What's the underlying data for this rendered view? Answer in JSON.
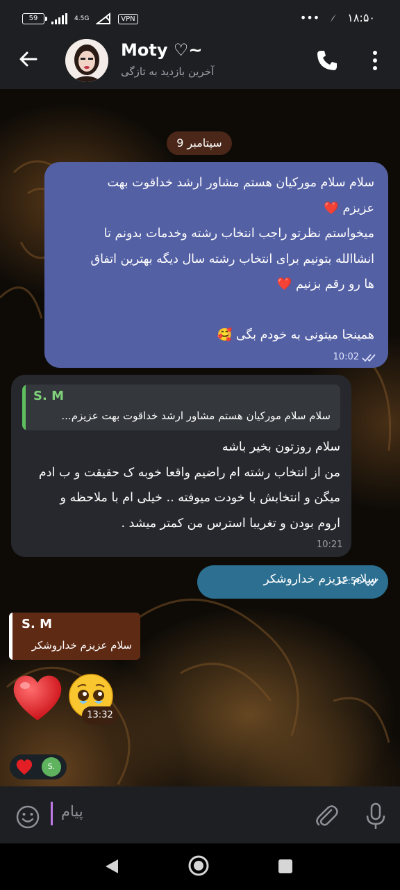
{
  "status_bar": {
    "battery": "59",
    "network": "4.5G",
    "vpn": "VPN",
    "icons": [
      "battery-icon",
      "signal-icon",
      "wifi-off-icon",
      "vpn-icon",
      "more-dots-icon",
      "location-arrow-icon"
    ],
    "time": "۱۸:۵۰"
  },
  "header": {
    "contact_name": "Moty ♡~",
    "last_seen": "آخرین بازدید به تازگی",
    "icons": [
      "back-arrow-icon",
      "phone-icon",
      "more-vert-icon"
    ]
  },
  "chat": {
    "date_label": "9 سپتامبر",
    "messages": [
      {
        "direction": "outgoing",
        "lines": [
          "سلام سلام  مورکیان هستم مشاور ارشد خداقوت بهت",
          "عزیزم ❤️",
          "میخواستم نظرتو راجب انتخاب رشته وخدمات بدونم تا",
          "انشاالله بتونیم برای انتخاب رشته سال دیگه  بهترین اتفاق",
          "ها رو رقم بزنیم ❤️",
          "",
          "همینجا میتونی به خودم بگی 🥰"
        ],
        "time": "10:02",
        "status": "read"
      },
      {
        "direction": "incoming",
        "reply": {
          "name": "S. M",
          "text": "سلام سلام  مورکیان هستم مشاور ارشد خداقوت بهت عزیزم..."
        },
        "lines": [
          "سلام روزتون بخیر باشه",
          "من از انتخاب رشته ام راضیم واقعا خوبه ک حقیقت و ب ادم",
          "میگن و انتخابش با خودت میوفته .. خیلی ام با ملاحظه و",
          "اروم بودن و تغریبا استرس من کمتر میشد ."
        ],
        "time": "10:21"
      },
      {
        "direction": "outgoing",
        "text": "سلام عزیزم خداروشکر",
        "time": "12:56",
        "status": "read"
      },
      {
        "direction": "incoming",
        "reply": {
          "name": "S. M",
          "text": "سلام عزیزم خداروشکر"
        },
        "emojis": [
          "heart-emoji",
          "pleading-face-emoji"
        ],
        "time": "13:32",
        "reactions": {
          "emoji": "heart-emoji",
          "user_initial": "S."
        }
      }
    ]
  },
  "input": {
    "placeholder": "پیام",
    "icons": [
      "emoji-smile-icon",
      "attach-paperclip-icon",
      "microphone-icon"
    ]
  },
  "navigation": {
    "icons": [
      "nav-back-icon",
      "nav-home-icon",
      "nav-recents-icon"
    ]
  },
  "colors": {
    "outgoing_bubble": "#5460a4",
    "outgoing_short_bubble": "#2c6f90",
    "incoming_bubble": "#26282d",
    "reply_accent_green": "#5fbf5f",
    "quote_bubble": "#5f2a14",
    "date_pill": "#4a2718"
  }
}
